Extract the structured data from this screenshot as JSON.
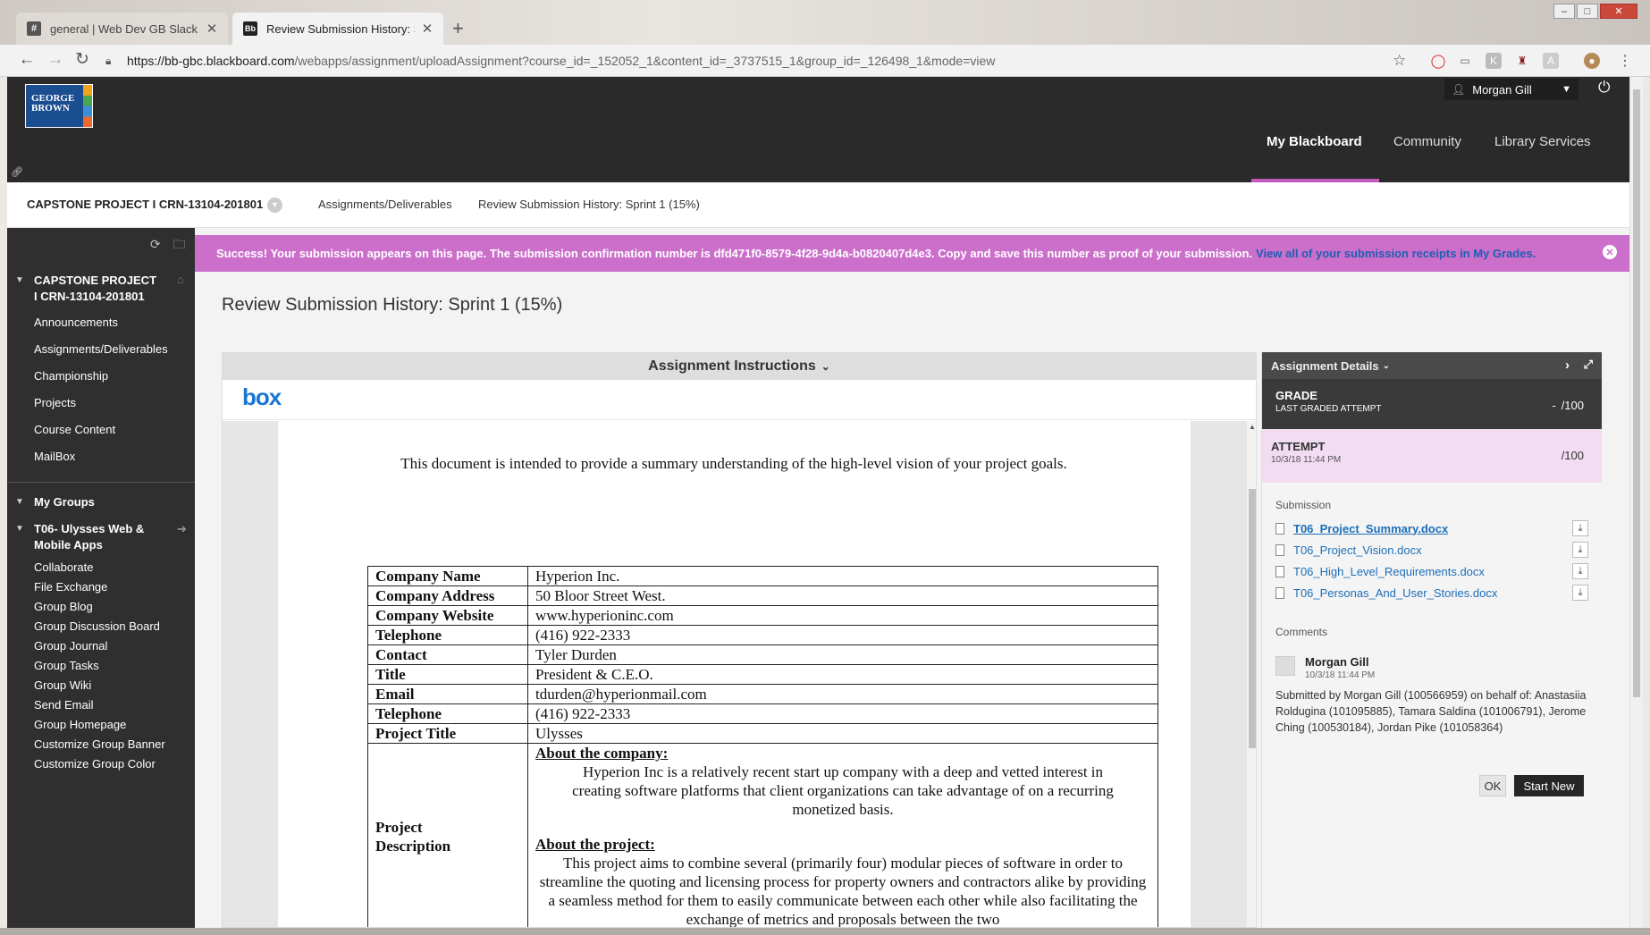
{
  "browser": {
    "tabs": [
      {
        "favicon": "#",
        "title": "general | Web Dev GB Slack"
      },
      {
        "favicon": "Bb",
        "title": "Review Submission History: Sprin"
      }
    ],
    "url_host": "https://bb-gbc.blackboard.com",
    "url_path": "/webapps/assignment/uploadAssignment?course_id=_152052_1&content_id=_3737515_1&group_id=_126498_1&mode=view"
  },
  "header": {
    "logo_line1": "GEORGE",
    "logo_line2": "BROWN",
    "user_name": "Morgan Gill",
    "nav": [
      "My Blackboard",
      "Community",
      "Library Services"
    ]
  },
  "breadcrumb": {
    "course": "CAPSTONE PROJECT I CRN-13104-201801",
    "items": [
      "Assignments/Deliverables",
      "Review Submission History: Sprint 1 (15%)"
    ]
  },
  "sidebar": {
    "course_title": "CAPSTONE PROJECT I CRN-13104-201801",
    "course_items": [
      "Announcements",
      "Assignments/Deliverables",
      "Championship",
      "Projects",
      "Course Content",
      "MailBox"
    ],
    "groups_title": "My Groups",
    "group_name": "T06- Ulysses Web & Mobile Apps",
    "group_items": [
      "Collaborate",
      "File Exchange",
      "Group Blog",
      "Group Discussion Board",
      "Group Journal",
      "Group Tasks",
      "Group Wiki",
      "Send Email",
      "Group Homepage",
      "Customize Group Banner",
      "Customize Group Color"
    ]
  },
  "banner": {
    "message": "Success! Your submission appears on this page. The submission confirmation number is dfd471f0-8579-4f28-9d4a-b0820407d4e3. Copy and save this number as proof of your submission.",
    "link": "View all of your submission receipts in My Grades."
  },
  "page": {
    "title": "Review Submission History: Sprint 1 (15%)",
    "instructions_label": "Assignment Instructions",
    "box_logo": "box"
  },
  "document": {
    "intro": "This document is intended to provide a summary understanding of the high-level vision of your project goals.",
    "rows": [
      {
        "k": "Company Name",
        "v": "Hyperion Inc."
      },
      {
        "k": "Company Address",
        "v": "50 Bloor Street West."
      },
      {
        "k": "Company Website",
        "v": "www.hyperioninc.com"
      },
      {
        "k": "Telephone",
        "v": "(416) 922-2333"
      },
      {
        "k": "Contact",
        "v": "Tyler Durden"
      },
      {
        "k": "Title",
        "v": "President & C.E.O."
      },
      {
        "k": "Email",
        "v": "tdurden@hyperionmail.com"
      },
      {
        "k": "Telephone",
        "v": "(416) 922-2333"
      },
      {
        "k": "Project Title",
        "v": "Ulysses"
      }
    ],
    "desc_key": "Project Description",
    "about_company_heading": "About the company:",
    "about_company_text": "Hyperion Inc is a relatively recent start up company with a deep and vetted interest in creating software platforms that client organizations can take advantage of on a recurring monetized basis.",
    "about_project_heading": "About the project:",
    "about_project_text": "This project aims to combine several (primarily four) modular pieces of software in order to streamline the quoting and licensing process for property owners and contractors alike by providing a seamless method for them to easily communicate between each other while also facilitating the exchange of metrics and proposals between the two"
  },
  "details": {
    "title": "Assignment Details",
    "grade_label": "GRADE",
    "grade_sub": "LAST GRADED ATTEMPT",
    "grade_value": "-",
    "grade_total": "/100",
    "attempt_label": "ATTEMPT",
    "attempt_time": "10/3/18 11:44 PM",
    "attempt_total": "/100",
    "submission_label": "Submission",
    "files": [
      "T06_Project_Summary.docx",
      "T06_Project_Vision.docx",
      "T06_High_Level_Requirements.docx",
      "T06_Personas_And_User_Stories.docx"
    ],
    "comments_label": "Comments",
    "comment_author": "Morgan Gill",
    "comment_time": "10/3/18 11:44 PM",
    "comment_text": "Submitted by Morgan Gill (100566959) on behalf of: Anastasiia Roldugina (101095885), Tamara Saldina (101006791), Jerome Ching (100530184), Jordan Pike (101058364)",
    "ok_label": "OK",
    "start_new_label": "Start New"
  }
}
